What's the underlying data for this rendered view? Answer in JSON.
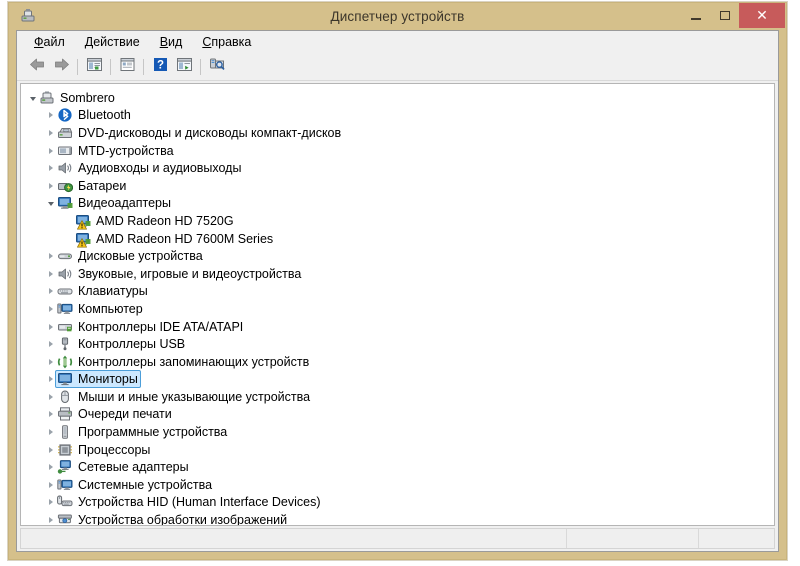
{
  "window": {
    "title": "Диспетчер устройств",
    "icon": "device-manager-icon",
    "controls": {
      "minimize_label": "Свернуть",
      "maximize_label": "Развернуть",
      "close_label": "Закрыть",
      "close_glyph": "✕"
    },
    "colors": {
      "frame": "#d5c08b",
      "close_button": "#c75b5b",
      "selection_fill": "#cce8ff",
      "selection_border": "#4c9ed9",
      "warning_badge": "#f5c518"
    }
  },
  "menubar": {
    "items": [
      {
        "name": "file",
        "accel": "Ф",
        "rest": "айл"
      },
      {
        "name": "action",
        "accel": "Д",
        "rest": "ействие"
      },
      {
        "name": "view",
        "accel": "В",
        "rest": "ид"
      },
      {
        "name": "help",
        "accel": "С",
        "rest": "правка"
      }
    ]
  },
  "toolbar": {
    "buttons": [
      {
        "icon": "back-arrow-icon",
        "tooltip": "Назад"
      },
      {
        "icon": "forward-arrow-icon",
        "tooltip": "Вперед"
      },
      {
        "sep": true
      },
      {
        "icon": "show-hide-console-tree-icon",
        "tooltip": "Показать/скрыть дерево консоли"
      },
      {
        "sep": true
      },
      {
        "icon": "properties-icon",
        "tooltip": "Свойства"
      },
      {
        "sep": true
      },
      {
        "icon": "help-icon",
        "tooltip": "Справка"
      },
      {
        "icon": "update-driver-icon",
        "tooltip": "Обновить драйвер"
      },
      {
        "sep": true
      },
      {
        "icon": "scan-hardware-changes-icon",
        "tooltip": "Обновить конфигурацию оборудования"
      }
    ]
  },
  "tree": {
    "nodes": [
      {
        "label": "Sombrero",
        "indent": 0,
        "state": "expanded",
        "icon": "computer-root-icon",
        "selected": false,
        "warning": false
      },
      {
        "label": "Bluetooth",
        "indent": 1,
        "state": "collapsed",
        "icon": "bluetooth-icon",
        "selected": false,
        "warning": false
      },
      {
        "label": "DVD-дисководы и дисководы компакт-дисков",
        "indent": 1,
        "state": "collapsed",
        "icon": "dvd-drive-icon",
        "selected": false,
        "warning": false
      },
      {
        "label": "MTD-устройства",
        "indent": 1,
        "state": "collapsed",
        "icon": "mtd-device-icon",
        "selected": false,
        "warning": false
      },
      {
        "label": "Аудиовходы и аудиовыходы",
        "indent": 1,
        "state": "collapsed",
        "icon": "audio-io-icon",
        "selected": false,
        "warning": false
      },
      {
        "label": "Батареи",
        "indent": 1,
        "state": "collapsed",
        "icon": "battery-icon",
        "selected": false,
        "warning": false
      },
      {
        "label": "Видеоадаптеры",
        "indent": 1,
        "state": "expanded",
        "icon": "display-adapter-icon",
        "selected": false,
        "warning": false
      },
      {
        "label": "AMD Radeon HD 7520G",
        "indent": 2,
        "state": "none",
        "icon": "display-adapter-icon",
        "selected": false,
        "warning": true
      },
      {
        "label": "AMD Radeon HD 7600M Series",
        "indent": 2,
        "state": "none",
        "icon": "display-adapter-icon",
        "selected": false,
        "warning": true
      },
      {
        "label": "Дисковые устройства",
        "indent": 1,
        "state": "collapsed",
        "icon": "disk-drive-icon",
        "selected": false,
        "warning": false
      },
      {
        "label": "Звуковые, игровые и видеоустройства",
        "indent": 1,
        "state": "collapsed",
        "icon": "sound-device-icon",
        "selected": false,
        "warning": false
      },
      {
        "label": "Клавиатуры",
        "indent": 1,
        "state": "collapsed",
        "icon": "keyboard-icon",
        "selected": false,
        "warning": false
      },
      {
        "label": "Компьютер",
        "indent": 1,
        "state": "collapsed",
        "icon": "computer-icon",
        "selected": false,
        "warning": false
      },
      {
        "label": "Контроллеры IDE ATA/ATAPI",
        "indent": 1,
        "state": "collapsed",
        "icon": "ide-controller-icon",
        "selected": false,
        "warning": false
      },
      {
        "label": "Контроллеры USB",
        "indent": 1,
        "state": "collapsed",
        "icon": "usb-controller-icon",
        "selected": false,
        "warning": false
      },
      {
        "label": "Контроллеры запоминающих устройств",
        "indent": 1,
        "state": "collapsed",
        "icon": "storage-controller-icon",
        "selected": false,
        "warning": false
      },
      {
        "label": "Мониторы",
        "indent": 1,
        "state": "collapsed",
        "icon": "monitor-icon",
        "selected": true,
        "warning": false
      },
      {
        "label": "Мыши и иные указывающие устройства",
        "indent": 1,
        "state": "collapsed",
        "icon": "mouse-icon",
        "selected": false,
        "warning": false
      },
      {
        "label": "Очереди печати",
        "indent": 1,
        "state": "collapsed",
        "icon": "printer-icon",
        "selected": false,
        "warning": false
      },
      {
        "label": "Программные устройства",
        "indent": 1,
        "state": "collapsed",
        "icon": "software-device-icon",
        "selected": false,
        "warning": false
      },
      {
        "label": "Процессоры",
        "indent": 1,
        "state": "collapsed",
        "icon": "processor-icon",
        "selected": false,
        "warning": false
      },
      {
        "label": "Сетевые адаптеры",
        "indent": 1,
        "state": "collapsed",
        "icon": "network-adapter-icon",
        "selected": false,
        "warning": false
      },
      {
        "label": "Системные устройства",
        "indent": 1,
        "state": "collapsed",
        "icon": "system-device-icon",
        "selected": false,
        "warning": false
      },
      {
        "label": "Устройства HID (Human Interface Devices)",
        "indent": 1,
        "state": "collapsed",
        "icon": "hid-device-icon",
        "selected": false,
        "warning": false
      },
      {
        "label": "Устройства обработки изображений",
        "indent": 1,
        "state": "collapsed",
        "icon": "imaging-device-icon",
        "selected": false,
        "warning": false
      }
    ]
  },
  "statusbar": {
    "panes": [
      {
        "text": ""
      },
      {
        "text": ""
      },
      {
        "text": ""
      }
    ]
  }
}
